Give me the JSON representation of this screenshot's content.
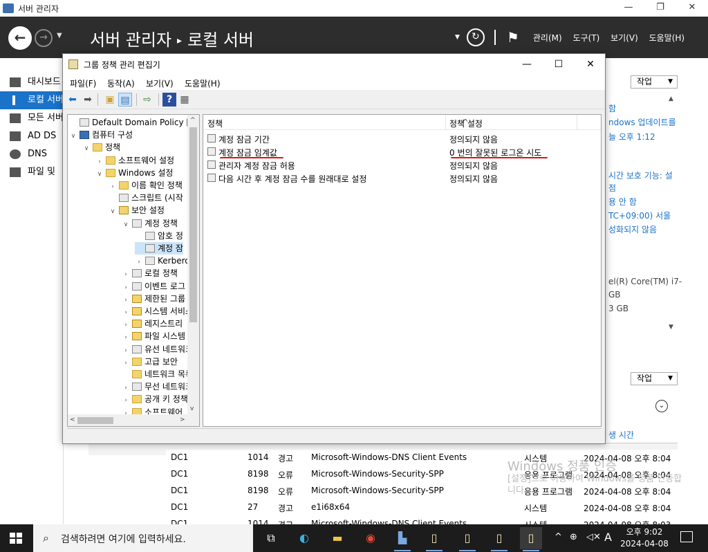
{
  "server_manager": {
    "title": "서버 관리자",
    "breadcrumb_app": "서버 관리자",
    "breadcrumb_page": "로컬 서버",
    "menu": [
      "관리(M)",
      "도구(T)",
      "보기(V)",
      "도움말(H)"
    ],
    "sidebar": [
      {
        "label": "대시보드",
        "icon": "dashboard-icon"
      },
      {
        "label": "로컬 서버",
        "icon": "local-server-icon",
        "active": true
      },
      {
        "label": "모든 서버",
        "icon": "all-servers-icon"
      },
      {
        "label": "AD DS",
        "icon": "ad-ds-icon"
      },
      {
        "label": "DNS",
        "icon": "dns-icon"
      },
      {
        "label": "파일 및",
        "icon": "file-storage-icon"
      }
    ],
    "tasks_label": "작업",
    "properties_right": [
      "함",
      "ndows 업데이트를",
      "늘 오후 1:12",
      "시간 보호 기능: 설",
      "점",
      "용 안 함",
      "TC+09:00) 서울",
      "성화되지 않음",
      "el(R) Core(TM) i7-",
      "GB",
      "3 GB"
    ],
    "events_time_header": "생 시간",
    "events": [
      {
        "server": "DC1",
        "id": "1014",
        "level": "경고",
        "source": "Microsoft-Windows-DNS Client Events",
        "log": "시스템",
        "time": "2024-04-08 오후 8:04"
      },
      {
        "server": "DC1",
        "id": "8198",
        "level": "오류",
        "source": "Microsoft-Windows-Security-SPP",
        "log": "응용 프로그램",
        "time": "2024-04-08 오후 8:04"
      },
      {
        "server": "DC1",
        "id": "8198",
        "level": "오류",
        "source": "Microsoft-Windows-Security-SPP",
        "log": "응용 프로그램",
        "time": "2024-04-08 오후 8:04"
      },
      {
        "server": "DC1",
        "id": "27",
        "level": "경고",
        "source": "e1i68x64",
        "log": "시스템",
        "time": "2024-04-08 오후 8:04"
      },
      {
        "server": "DC1",
        "id": "1014",
        "level": "경고",
        "source": "Microsoft-Windows-DNS Client Events",
        "log": "시스템",
        "time": "2024-04-08 오후 8:03"
      }
    ],
    "watermark_line1": "Windows 정품 인증",
    "watermark_line2": "[설정]으로 이동하여 Windows를 정품 인증합니다."
  },
  "gpe": {
    "title": "그룹 정책 관리 편집기",
    "menu": [
      "파일(F)",
      "동작(A)",
      "보기(V)",
      "도움말(H)"
    ],
    "tree": [
      {
        "label": "Default Domain Policy [DC",
        "depth": 0,
        "exp": "",
        "icon": "doc"
      },
      {
        "label": "컴퓨터 구성",
        "depth": 0,
        "exp": "v",
        "icon": "pc"
      },
      {
        "label": "정책",
        "depth": 1,
        "exp": "v",
        "icon": "folder"
      },
      {
        "label": "소프트웨어 설정",
        "depth": 2,
        "exp": ">",
        "icon": "folder"
      },
      {
        "label": "Windows 설정",
        "depth": 2,
        "exp": "v",
        "icon": "folder"
      },
      {
        "label": "이름 확인 정책",
        "depth": 3,
        "exp": ">",
        "icon": "folder"
      },
      {
        "label": "스크립트 (시작",
        "depth": 3,
        "exp": "",
        "icon": "doc"
      },
      {
        "label": "보안 설정",
        "depth": 3,
        "exp": "v",
        "icon": "lock"
      },
      {
        "label": "계정 정책",
        "depth": 4,
        "exp": "v",
        "icon": "doc"
      },
      {
        "label": "암호 정",
        "depth": 5,
        "exp": "",
        "icon": "doc"
      },
      {
        "label": "계정 잠",
        "depth": 5,
        "exp": "",
        "icon": "doc",
        "selected": true
      },
      {
        "label": "Kerberos",
        "depth": 5,
        "exp": ">",
        "icon": "doc"
      },
      {
        "label": "로컬 정책",
        "depth": 4,
        "exp": ">",
        "icon": "doc"
      },
      {
        "label": "이벤트 로그",
        "depth": 4,
        "exp": ">",
        "icon": "doc"
      },
      {
        "label": "제한된 그룹",
        "depth": 4,
        "exp": ">",
        "icon": "lock"
      },
      {
        "label": "시스템 서비스",
        "depth": 4,
        "exp": ">",
        "icon": "lock"
      },
      {
        "label": "레지스트리",
        "depth": 4,
        "exp": ">",
        "icon": "lock"
      },
      {
        "label": "파일 시스템",
        "depth": 4,
        "exp": ">",
        "icon": "lock"
      },
      {
        "label": "유선 네트워크",
        "depth": 4,
        "exp": ">",
        "icon": "doc"
      },
      {
        "label": "고급 보안",
        "depth": 4,
        "exp": ">",
        "icon": "folder"
      },
      {
        "label": "네트워크 목록",
        "depth": 4,
        "exp": "",
        "icon": "folder"
      },
      {
        "label": "무선 네트워크",
        "depth": 4,
        "exp": ">",
        "icon": "doc"
      },
      {
        "label": "공개 키 정책",
        "depth": 4,
        "exp": ">",
        "icon": "folder"
      },
      {
        "label": "소프트웨어",
        "depth": 4,
        "exp": ">",
        "icon": "folder"
      }
    ],
    "columns": {
      "policy": "정책",
      "setting": "정책 설정"
    },
    "rows": [
      {
        "policy": "계정 잠금 기간",
        "setting": "정의되지 않음"
      },
      {
        "policy": "계정 잠금 임계값",
        "setting": "0 번의 잘못된 로그온 시도"
      },
      {
        "policy": "관리자 계정 잠금 허용",
        "setting": "정의되지 않음"
      },
      {
        "policy": "다음 시간 후 계정 잠금 수를 원래대로 설정",
        "setting": "정의되지 않음"
      }
    ]
  },
  "taskbar": {
    "search_placeholder": "검색하려면 여기에 입력하세요.",
    "time": "오후 9:02",
    "date": "2024-04-08",
    "ime": "A",
    "apps": [
      "task-view-icon",
      "edge-icon",
      "file-explorer-icon",
      "chrome-icon",
      "server-manager-icon",
      "gpo-icon",
      "gpo-icon",
      "gpo-icon",
      "gpo-icon"
    ]
  },
  "colors": {
    "accent": "#1a72c9",
    "header": "#2d2d2d",
    "annotation": "#e01010"
  }
}
